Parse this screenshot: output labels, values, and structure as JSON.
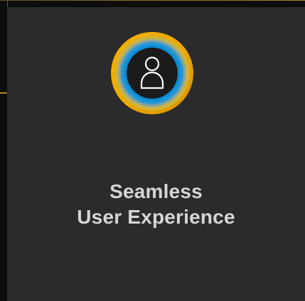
{
  "card": {
    "title_line1": "Seamless",
    "title_line2": "User Experience",
    "icon": "user-icon"
  },
  "colors": {
    "page_background": "#0d0d0d",
    "card_background": "#2b2b2b",
    "title_text": "#d6d6d6",
    "accent_gold": "#f1a800",
    "accent_blue": "#0a8fd8",
    "icon_stroke": "#ffffff",
    "icon_fill": "#1b1b1b"
  }
}
